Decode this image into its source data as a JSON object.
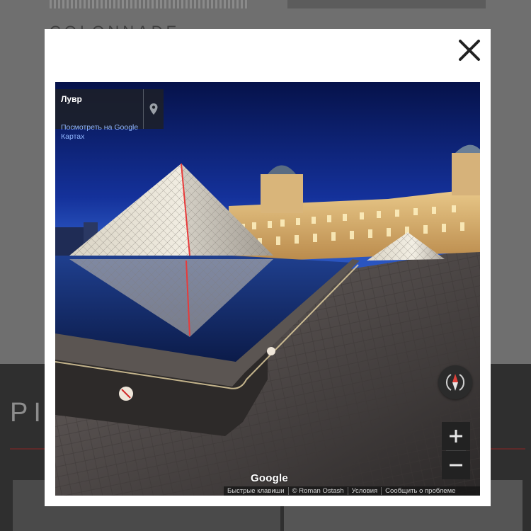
{
  "background": {
    "heading_top": "COLONNADE",
    "heading_bottom": "PIC"
  },
  "modal": {
    "close_icon": "close-icon"
  },
  "streetview": {
    "place_title": "Лувр",
    "maps_link": "Посмотреть на Google Картах",
    "pin_icon": "map-pin-icon",
    "compass_icon": "compass-icon",
    "zoom_in_icon": "plus-icon",
    "zoom_out_icon": "minus-icon",
    "logo": "Google",
    "footer": {
      "shortcuts": "Быстрые клавиши",
      "copyright": "© Roman Ostash",
      "terms": "Условия",
      "report": "Сообщить о проблеме"
    }
  },
  "colors": {
    "sky": "#0d1d55",
    "pyramid_accent": "#e83a3a",
    "link": "#8fb6ff"
  }
}
